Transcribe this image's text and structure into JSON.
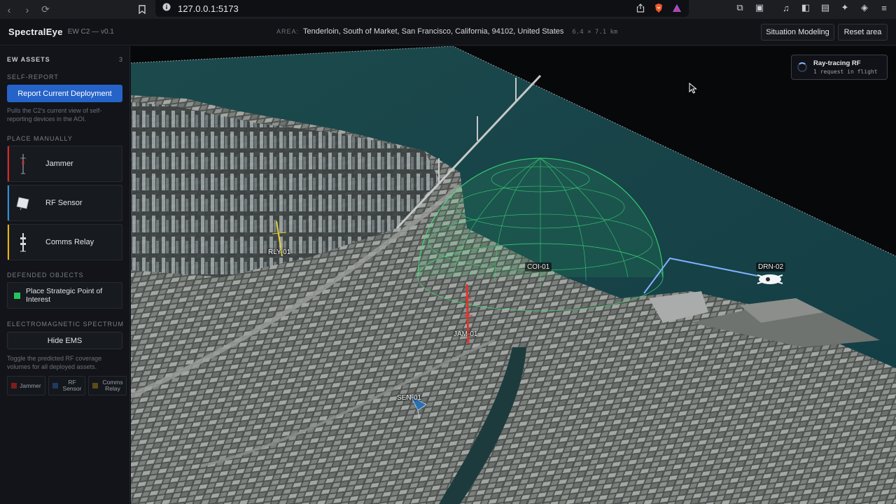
{
  "browser": {
    "url": "127.0.0.1:5173"
  },
  "header": {
    "brand": "SpectralEye",
    "version": "EW C2 — v0.1",
    "area_label": "AREA:",
    "area_value": "Tenderloin, South of Market, San Francisco, California, 94102, United States",
    "area_size": "6.4 × 7.1 km",
    "situation_button": "Situation Modeling",
    "reset_button": "Reset area"
  },
  "sidebar": {
    "title": "EW ASSETS",
    "count": "3",
    "self_report_label": "SELF-REPORT",
    "report_button": "Report Current Deployment",
    "report_help": "Pulls the C2's current view of self-reporting devices in the AOI.",
    "place_manually_label": "PLACE MANUALLY",
    "assets": [
      {
        "label": "Jammer",
        "color": "#dc2626",
        "icon": "jammer-tower-icon"
      },
      {
        "label": "RF Sensor",
        "color": "#2f8fd8",
        "icon": "rf-sensor-panel-icon"
      },
      {
        "label": "Comms Relay",
        "color": "#eab308",
        "icon": "comms-relay-mast-icon"
      }
    ],
    "defended_label": "DEFENDED OBJECTS",
    "poi_button": "Place Strategic Point of Interest",
    "poi_color": "#22c55e",
    "ems_label": "ELECTROMAGNETIC SPECTRUM",
    "hide_ems_button": "Hide EMS",
    "ems_help": "Toggle the predicted RF coverage volumes for all deployed assets.",
    "legend": [
      {
        "label": "Jammer",
        "color": "#7f1d1d"
      },
      {
        "label": "RF Sensor",
        "color": "#1e3a5f"
      },
      {
        "label": "Comms Relay",
        "color": "#5c4a1a"
      }
    ]
  },
  "map": {
    "status_title": "Ray-tracing RF",
    "status_sub": "1 request in flight",
    "labels": {
      "rly": "RLY-01",
      "coi": "COI-01",
      "drn": "DRN-02",
      "jam": "JAM-01",
      "sen": "SEN-01"
    },
    "coverage_color": "#3ee27a",
    "link_color": "#7fb2ff"
  }
}
